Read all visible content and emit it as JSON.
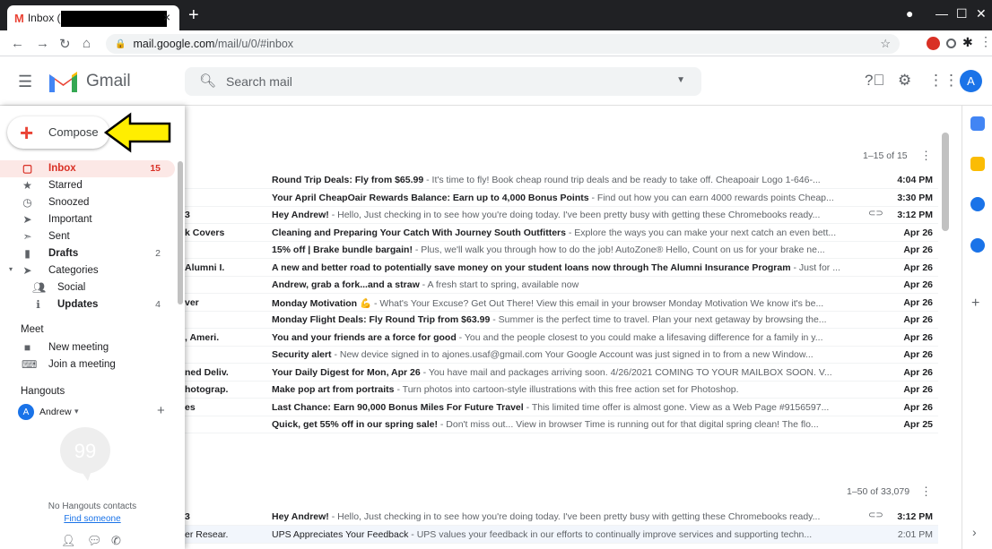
{
  "browser": {
    "tab_title": "Inbox (15)",
    "url_host": "mail.google.com",
    "url_path": "/mail/u/0/#inbox"
  },
  "header": {
    "app_name": "Gmail",
    "search_placeholder": "Search mail",
    "avatar_letter": "A"
  },
  "sidebar": {
    "compose_label": "Compose",
    "items": [
      {
        "label": "Inbox",
        "count": "15",
        "icon": "inbox-icon"
      },
      {
        "label": "Starred",
        "count": "",
        "icon": "star-icon"
      },
      {
        "label": "Snoozed",
        "count": "",
        "icon": "clock-icon"
      },
      {
        "label": "Important",
        "count": "",
        "icon": "important-icon"
      },
      {
        "label": "Sent",
        "count": "",
        "icon": "send-icon"
      },
      {
        "label": "Drafts",
        "count": "2",
        "icon": "draft-icon"
      },
      {
        "label": "Categories",
        "count": "",
        "icon": "label-icon"
      },
      {
        "label": "Social",
        "count": "",
        "icon": "people-icon"
      },
      {
        "label": "Updates",
        "count": "4",
        "icon": "info-icon"
      }
    ],
    "meet_title": "Meet",
    "meet_items": [
      "New meeting",
      "Join a meeting"
    ],
    "hangouts_title": "Hangouts",
    "hangouts_user": "Andrew",
    "hangouts_user_initial": "A",
    "no_contacts": "No Hangouts contacts",
    "find_someone": "Find someone"
  },
  "inbox": {
    "paging_top": "1–15 of 15",
    "paging_bottom": "1–50 of 33,079",
    "rows": [
      {
        "sender": "",
        "subject": "Round Trip Deals: Fly from $65.99",
        "snippet": " - It's time to fly! Book cheap round trip deals and be ready to take off. Cheapoair Logo 1-646-...",
        "date": "4:04 PM",
        "attach": false,
        "read": false
      },
      {
        "sender": "",
        "subject": "Your April CheapOair Rewards Balance: Earn up to 4,000 Bonus Points",
        "snippet": " - Find out how you can earn 4000 rewards points Cheap...",
        "date": "3:30 PM",
        "attach": false,
        "read": false
      },
      {
        "sender": "3",
        "subject": "Hey Andrew!",
        "snippet": " - Hello, Just checking in to see how you're doing today. I've been pretty busy with getting these Chromebooks ready...",
        "date": "3:12 PM",
        "attach": true,
        "read": false
      },
      {
        "sender": "k Covers",
        "subject": "Cleaning and Preparing Your Catch With Journey South Outfitters",
        "snippet": " - Explore the ways you can make your next catch an even bett...",
        "date": "Apr 26",
        "attach": false,
        "read": false
      },
      {
        "sender": "",
        "subject": "15% off | Brake bundle bargain!",
        "snippet": " - Plus, we'll walk you through how to do the job! AutoZone® Hello, Count on us for your brake ne...",
        "date": "Apr 26",
        "attach": false,
        "read": false
      },
      {
        "sender": "Alumni I.",
        "subject": "A new and better road to potentially save money on your student loans now through The Alumni Insurance Program",
        "snippet": " - Just for ...",
        "date": "Apr 26",
        "attach": false,
        "read": false
      },
      {
        "sender": "",
        "subject": "Andrew, grab a fork...and a straw",
        "snippet": " - A fresh start to spring, available now",
        "date": "Apr 26",
        "attach": false,
        "read": false
      },
      {
        "sender": "ver",
        "subject": "Monday Motivation 💪",
        "snippet": " - What's Your Excuse? Get Out There! View this email in your browser Monday Motivation We know it's be...",
        "date": "Apr 26",
        "attach": false,
        "read": false
      },
      {
        "sender": "",
        "subject": "Monday Flight Deals: Fly Round Trip from $63.99",
        "snippet": " - Summer is the perfect time to travel. Plan your next getaway by browsing the...",
        "date": "Apr 26",
        "attach": false,
        "read": false
      },
      {
        "sender": ", Ameri.",
        "subject": "You and your friends are a force for good",
        "snippet": " - You and the people closest to you could make a lifesaving difference for a family in y...",
        "date": "Apr 26",
        "attach": false,
        "read": false
      },
      {
        "sender": "",
        "subject": "Security alert",
        "snippet": " - New device signed in to ajones.usaf@gmail.com Your Google Account was just signed in to from a new Window...",
        "date": "Apr 26",
        "attach": false,
        "read": false
      },
      {
        "sender": "ned Deliv.",
        "subject": "Your Daily Digest for Mon, Apr 26",
        "snippet": " - You have mail and packages arriving soon. 4/26/2021 COMING TO YOUR MAILBOX SOON. V...",
        "date": "Apr 26",
        "attach": false,
        "read": false
      },
      {
        "sender": "hotograp.",
        "subject": "Make pop art from portraits",
        "snippet": " - Turn photos into cartoon-style illustrations with this free action set for Photoshop.",
        "date": "Apr 26",
        "attach": false,
        "read": false
      },
      {
        "sender": "es",
        "subject": "Last Chance: Earn 90,000 Bonus Miles For Future Travel",
        "snippet": " - This limited time offer is almost gone. View as a Web Page #9156597...",
        "date": "Apr 26",
        "attach": false,
        "read": false
      },
      {
        "sender": "",
        "subject": "Quick, get 55% off in our spring sale!",
        "snippet": " - Don't miss out... View in browser Time is running out for that digital spring clean! The flo...",
        "date": "Apr 25",
        "attach": false,
        "read": false
      }
    ],
    "rows2": [
      {
        "sender": "3",
        "subject": "Hey Andrew!",
        "snippet": " - Hello, Just checking in to see how you're doing today. I've been pretty busy with getting these Chromebooks ready...",
        "date": "3:12 PM",
        "attach": true,
        "read": false
      },
      {
        "sender": "er Resear.",
        "subject": "UPS Appreciates Your Feedback",
        "snippet": " - UPS values your feedback in our efforts to continually improve services and supporting techn...",
        "date": "2:01 PM",
        "attach": false,
        "read": true
      }
    ]
  },
  "colors": {
    "gmail_red": "#ea4335",
    "accent_blue": "#1a73e8",
    "arrow_yellow": "#ffee00"
  }
}
